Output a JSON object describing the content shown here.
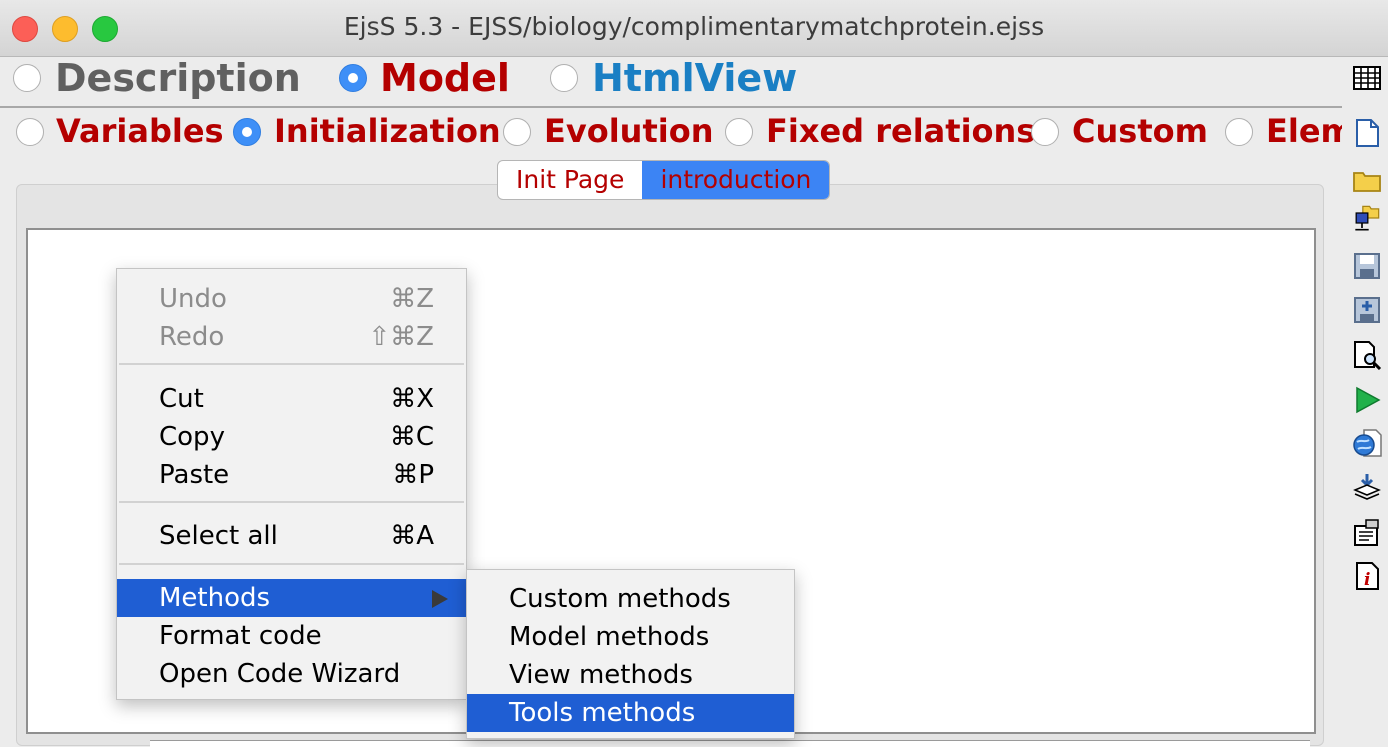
{
  "window": {
    "title": "EjsS 5.3 - EJSS/biology/complimentarymatchprotein.ejss"
  },
  "top_radios": [
    {
      "label": "Description",
      "selected": false,
      "color": "#606060"
    },
    {
      "label": "Model",
      "selected": true,
      "color": "#b40000"
    },
    {
      "label": "HtmlView",
      "selected": false,
      "color": "#1a7fc4"
    }
  ],
  "model_radios": [
    {
      "label": "Variables",
      "selected": false
    },
    {
      "label": "Initialization",
      "selected": true
    },
    {
      "label": "Evolution",
      "selected": false
    },
    {
      "label": "Fixed relations",
      "selected": false
    },
    {
      "label": "Custom",
      "selected": false
    },
    {
      "label": "Elem",
      "selected": false
    }
  ],
  "tabs": [
    {
      "label": "Init Page",
      "active": false
    },
    {
      "label": "introduction",
      "active": true
    }
  ],
  "context_menu": {
    "items": [
      {
        "label": "Undo",
        "shortcut": "⌘Z",
        "disabled": true
      },
      {
        "label": "Redo",
        "shortcut": "⇧⌘Z",
        "disabled": true
      },
      {
        "label": "Cut",
        "shortcut": "⌘X"
      },
      {
        "label": "Copy",
        "shortcut": "⌘C"
      },
      {
        "label": "Paste",
        "shortcut": "⌘P"
      },
      {
        "label": "Select all",
        "shortcut": "⌘A"
      },
      {
        "label": "Methods",
        "submenu": true,
        "highlighted": true
      },
      {
        "label": "Format code"
      },
      {
        "label": "Open Code Wizard"
      }
    ]
  },
  "methods_submenu": {
    "items": [
      {
        "label": "Custom methods"
      },
      {
        "label": "Model methods"
      },
      {
        "label": "View methods"
      },
      {
        "label": "Tools methods",
        "highlighted": true
      }
    ]
  },
  "side_toolbar": [
    "table-icon",
    "new-file-icon",
    "open-folder-icon",
    "network-folder-icon",
    "save-icon",
    "save-as-icon",
    "search-document-icon",
    "run-icon",
    "web-icon",
    "install-icon",
    "preferences-icon",
    "info-icon"
  ],
  "colors": {
    "accent": "#3c84f4",
    "highlight": "#1f5ed3",
    "label_red": "#b40000"
  }
}
